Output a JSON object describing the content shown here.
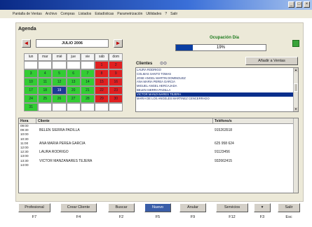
{
  "menu": [
    "Pantalla de Ventas",
    "Archivo",
    "Compras",
    "Listados",
    "Estadísticas",
    "Parametrización",
    "Utilidades",
    "?",
    "Salir"
  ],
  "window_buttons": [
    "_",
    "□",
    "×"
  ],
  "agenda": {
    "title": "Agenda",
    "month": "JULIO 2006",
    "prev_arrow": "◄",
    "next_arrow": "►",
    "weekdays": [
      "lun",
      "mar",
      "mié",
      "jue",
      "vie",
      "sáb",
      "dom"
    ],
    "weeks": [
      [
        "",
        "",
        "",
        "",
        "",
        "1",
        "2"
      ],
      [
        "3",
        "4",
        "5",
        "6",
        "7",
        "8",
        "9"
      ],
      [
        "10",
        "11",
        "12",
        "13",
        "14",
        "15",
        "16"
      ],
      [
        "17",
        "18",
        "19",
        "20",
        "21",
        "22",
        "23"
      ],
      [
        "24",
        "25",
        "26",
        "27",
        "28",
        "29",
        "30"
      ],
      [
        "31",
        "",
        "",
        "",
        "",
        "",
        ""
      ]
    ],
    "selected_day": "19",
    "colors": {
      "weekday": "#33cc33",
      "weekend": "#e02020",
      "selected": "#1c3a96"
    }
  },
  "ocupacion": {
    "label": "Ocupación Día",
    "value": 19,
    "text": "19%"
  },
  "clientes": {
    "label": "Clientes",
    "filter_icon": "binoculars-icon",
    "add_button": "Añadir a Ventas",
    "items": [
      "LAURA RODRIGO",
      "COLMAS SANTO TOMAS",
      "JOSE ANGEL MARTIN DOMINGUEZ",
      "ANA MARIA PEREA GARCIA",
      "MIGUEL ANGEL HERCAJADA",
      "BELEN SIERRA PADILLA",
      "VICTOR MANZANARES TEJERA",
      "MARIA DE LOS ANGELES MARTINEZ CENCERRADO"
    ],
    "selected_index": 6
  },
  "schedule": {
    "columns": [
      "Hora",
      "Cliente",
      "Teléfono/s"
    ],
    "rows": [
      {
        "hora": "09:00",
        "cliente": "",
        "tel": ""
      },
      {
        "hora": "09:30",
        "cliente": "BELEN SIERRA PADILLA",
        "tel": "915263518"
      },
      {
        "hora": "10:00",
        "cliente": "",
        "tel": ""
      },
      {
        "hora": "10:30",
        "cliente": "",
        "tel": ""
      },
      {
        "hora": "11:00",
        "cliente": "ANA MARIA PEREA GARCIA",
        "tel": "625 958 624"
      },
      {
        "hora": "12:00",
        "cliente": "",
        "tel": ""
      },
      {
        "hora": "12:30",
        "cliente": "LAURA RODRIGO",
        "tel": "91123456"
      },
      {
        "hora": "13:00",
        "cliente": "",
        "tel": ""
      },
      {
        "hora": "13:30",
        "cliente": "VICTOR MANZANARES TEJERA",
        "tel": "932662415"
      },
      {
        "hora": "14:00",
        "cliente": "",
        "tel": ""
      }
    ]
  },
  "buttons": [
    {
      "label": "Profesional",
      "key": "F7"
    },
    {
      "label": "Crear Cliente",
      "key": "F4"
    },
    {
      "label": "Buscar",
      "key": "F2"
    },
    {
      "label": "Nuevo",
      "key": "F5"
    },
    {
      "label": "Anular",
      "key": "F9"
    },
    {
      "label": "Servicios",
      "key": "F12"
    },
    {
      "label": "▾",
      "key": "F3"
    },
    {
      "label": "Salir",
      "key": "Esc"
    }
  ]
}
